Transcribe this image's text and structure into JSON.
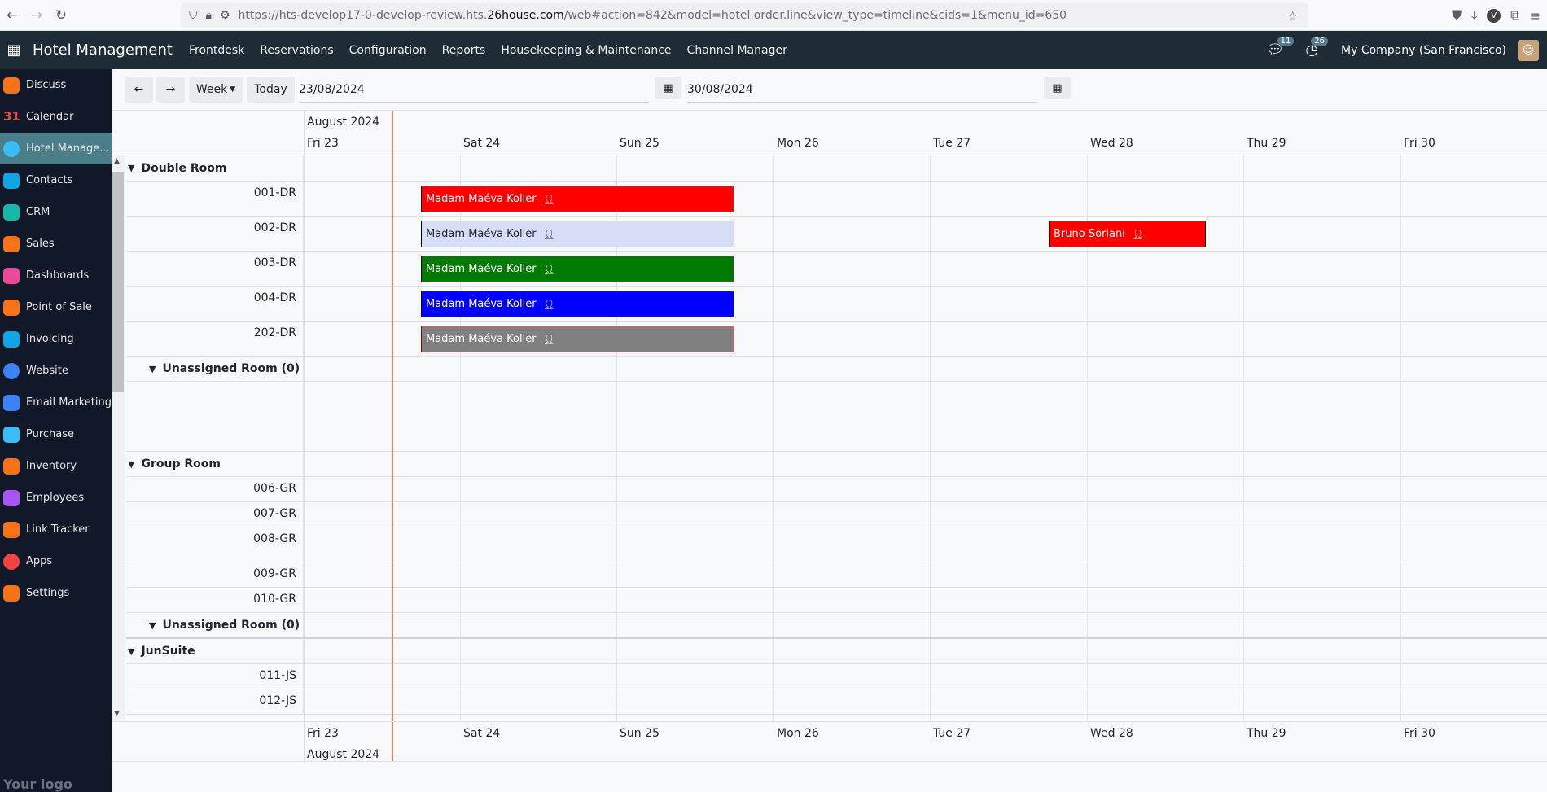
{
  "browser": {
    "url_prefix": "https://hts-develop17-0-develop-review.hts.",
    "url_domain": "26house.com",
    "url_suffix": "/web#action=842&model=hotel.order.line&view_type=timeline&cids=1&menu_id=650"
  },
  "topnav": {
    "title": "Hotel Management",
    "menu": [
      "Frontdesk",
      "Reservations",
      "Configuration",
      "Reports",
      "Housekeeping & Maintenance",
      "Channel Manager"
    ],
    "messages_count": "11",
    "activities_count": "26",
    "company": "My Company (San Francisco)"
  },
  "sidebar": {
    "items": [
      {
        "label": "Discuss",
        "color": "#f97316"
      },
      {
        "label": "Calendar",
        "color": "#ef4444"
      },
      {
        "label": "Hotel Manage...",
        "color": "#38bdf8"
      },
      {
        "label": "Contacts",
        "color": "#0ea5e9"
      },
      {
        "label": "CRM",
        "color": "#14b8a6"
      },
      {
        "label": "Sales",
        "color": "#f97316"
      },
      {
        "label": "Dashboards",
        "color": "#ec4899"
      },
      {
        "label": "Point of Sale",
        "color": "#f97316"
      },
      {
        "label": "Invoicing",
        "color": "#0ea5e9"
      },
      {
        "label": "Website",
        "color": "#3b82f6"
      },
      {
        "label": "Email Marketing",
        "color": "#3b82f6"
      },
      {
        "label": "Purchase",
        "color": "#38bdf8"
      },
      {
        "label": "Inventory",
        "color": "#f97316"
      },
      {
        "label": "Employees",
        "color": "#a855f7"
      },
      {
        "label": "Link Tracker",
        "color": "#f97316"
      },
      {
        "label": "Apps",
        "color": "#ef4444"
      },
      {
        "label": "Settings",
        "color": "#f97316"
      }
    ],
    "logo": "Your logo"
  },
  "toolbar": {
    "prev": "←",
    "next": "→",
    "scale": "Week",
    "today": "Today",
    "start_date": "23/08/2024",
    "end_date": "30/08/2024"
  },
  "timeline": {
    "month": "August 2024",
    "days": [
      "Fri 23",
      "Sat 24",
      "Sun 25",
      "Mon 26",
      "Tue 27",
      "Wed 28",
      "Thu 29",
      "Fri 30"
    ],
    "groups": {
      "double": "Double Room",
      "double_unassigned": "Unassigned Room (0)",
      "group": "Group Room",
      "group_unassigned": "Unassigned Room (0)",
      "junsuite": "JunSuite"
    },
    "rooms": {
      "r001": "001-DR",
      "r002": "002-DR",
      "r003": "003-DR",
      "r004": "004-DR",
      "r202": "202-DR",
      "r006": "006-GR",
      "r007": "007-GR",
      "r008": "008-GR",
      "r009": "009-GR",
      "r010": "010-GR",
      "r011": "011-JS",
      "r012": "012-JS"
    },
    "reservations": [
      {
        "guest": "Madam Maéva Koller",
        "bg": "#ff0000",
        "fg": "#ffffff"
      },
      {
        "guest": "Madam Maéva Koller",
        "bg": "#d6def7",
        "fg": "#212529"
      },
      {
        "guest": "Bruno Soriani",
        "bg": "#ff0000",
        "fg": "#ffffff"
      },
      {
        "guest": "Madam Maéva Koller",
        "bg": "#007a00",
        "fg": "#ffffff"
      },
      {
        "guest": "Madam Maéva Koller",
        "bg": "#0000ff",
        "fg": "#ffffff"
      },
      {
        "guest": "Madam Maéva Koller",
        "bg": "#808080",
        "fg": "#ffffff"
      }
    ]
  }
}
